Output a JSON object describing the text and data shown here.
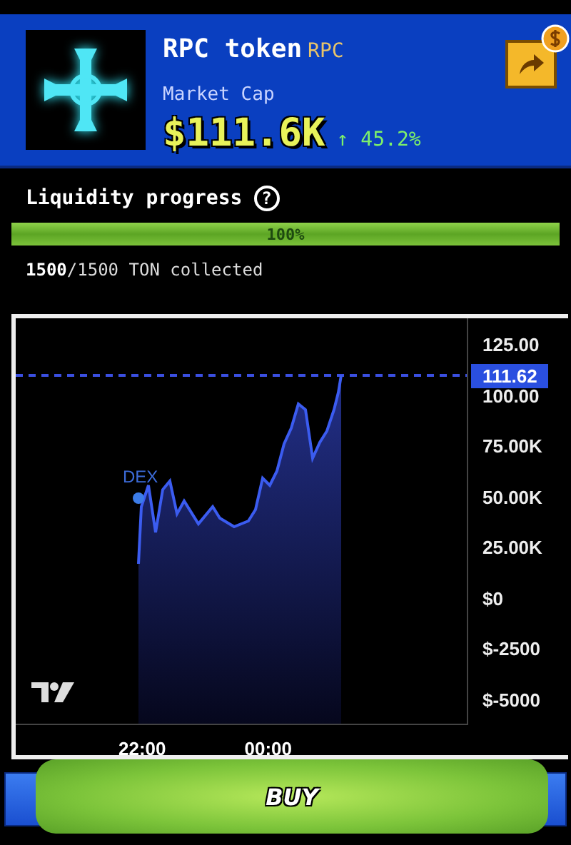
{
  "token": {
    "name": "RPC token",
    "ticker": "RPC",
    "market_cap_label": "Market Cap",
    "market_cap": "$111.6K",
    "change": "↑ 45.2%"
  },
  "liquidity": {
    "title": "Liquidity progress",
    "help": "?",
    "level": 1,
    "percent": "100%",
    "collected": "**1500**/1500 TON collected"
  },
  "chart": {
    "y_labels": [
      "125.00",
      "100.00",
      "75.00K",
      "50.00K",
      "25.00K",
      "$0",
      "$-2500",
      "$-5000"
    ],
    "price_tag": "111.62",
    "marker": "DEX",
    "x_labels": [
      "22:00",
      "00:00"
    ]
  },
  "buy_button": "BUY"
}
